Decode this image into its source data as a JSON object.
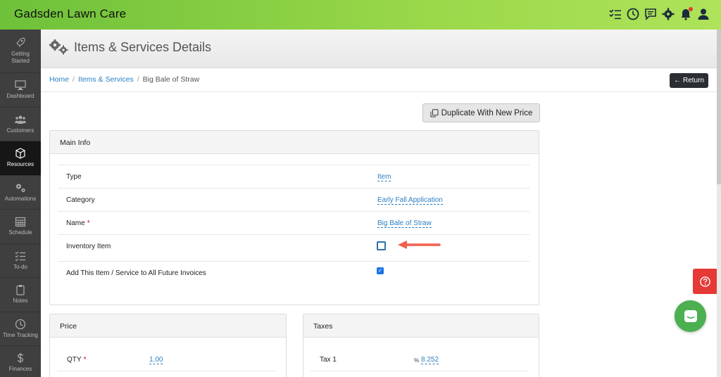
{
  "app": {
    "brand": "Gadsden Lawn Care"
  },
  "top_icons": [
    "tasks-icon",
    "clock-icon",
    "chat-icon",
    "gear-icon",
    "bell-icon",
    "user-icon"
  ],
  "sidebar": {
    "items": [
      {
        "label_line1": "Getting",
        "label_line2": "Started",
        "icon": "rocket-icon",
        "active": false
      },
      {
        "label": "Dashboard",
        "icon": "monitor-icon",
        "active": false
      },
      {
        "label": "Customers",
        "icon": "users-icon",
        "active": false
      },
      {
        "label": "Resources",
        "icon": "cube-icon",
        "active": true
      },
      {
        "label": "Automations",
        "icon": "gears-icon",
        "active": false
      },
      {
        "label": "Schedule",
        "icon": "calendar-icon",
        "active": false
      },
      {
        "label": "To-do",
        "icon": "checklist-icon",
        "active": false
      },
      {
        "label": "Notes",
        "icon": "clipboard-icon",
        "active": false
      },
      {
        "label": "Time Tracking",
        "icon": "clock-icon",
        "active": false
      },
      {
        "label": "Finances",
        "icon": "dollar-icon",
        "active": false
      }
    ]
  },
  "page": {
    "title": "Items & Services Details"
  },
  "breadcrumb": {
    "home": "Home",
    "section": "Items & Services",
    "current": "Big Bale of Straw",
    "separator": "/"
  },
  "buttons": {
    "return": "Return",
    "duplicate": "Duplicate With New Price"
  },
  "main_info": {
    "title": "Main Info",
    "type_label": "Type",
    "type_value": "Item",
    "category_label": "Category",
    "category_value": "Early Fall Application",
    "name_label": "Name",
    "name_value": "Big Bale of Straw",
    "required_mark": "*",
    "inventory_label": "Inventory Item",
    "inventory_checked": false,
    "future_invoices_label": "Add This Item / Service to All Future Invoices",
    "future_invoices_checked": true
  },
  "price": {
    "title": "Price",
    "qty_label": "QTY",
    "qty_value": "1.00"
  },
  "taxes": {
    "title": "Taxes",
    "tax1_label": "Tax 1",
    "tax1_prefix": "%",
    "tax1_value": "8.252"
  },
  "colors": {
    "topbar": "#8fd149",
    "sidebar": "#3f3f3f",
    "link": "#2a7fc1",
    "help": "#e53935",
    "chat": "#4caf50",
    "arrow": "#f0604d"
  }
}
